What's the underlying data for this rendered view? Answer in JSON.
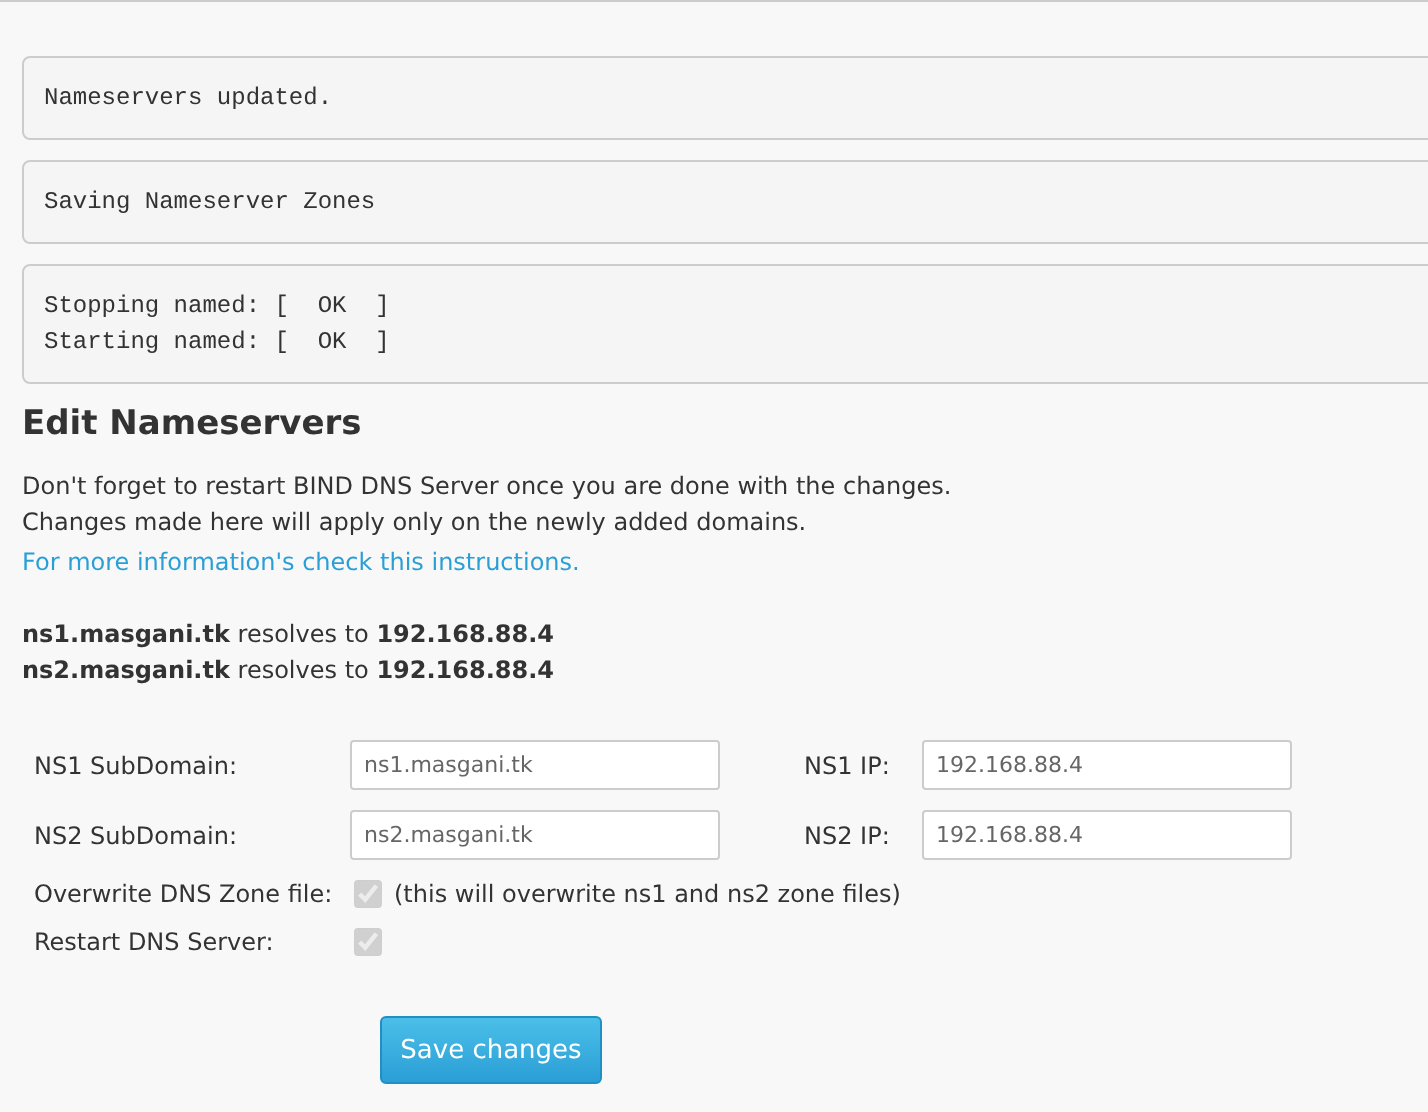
{
  "messages": [
    {
      "lines": [
        "Nameservers updated."
      ]
    },
    {
      "lines": [
        "Saving Nameserver Zones"
      ]
    },
    {
      "lines": [
        "Stopping named: [  OK  ]",
        "Starting named: [  OK  ]"
      ]
    }
  ],
  "heading": "Edit Nameservers",
  "notes": [
    "Don't forget to restart BIND DNS Server once you are done with the changes.",
    "Changes made here will apply only on the newly added domains."
  ],
  "link": "For more information's check this instructions.",
  "resolves": [
    "**ns1.masgani.tk** resolves to **192.168.88.4**",
    "**ns2.masgani.tk** resolves to **192.168.88.4**"
  ],
  "fields": [
    {
      "label": "NS1 SubDomain:",
      "value": "ns1.masgani.tk",
      "ip_label": "NS1 IP:",
      "ip_value": "192.168.88.4"
    },
    {
      "label": "NS2 SubDomain:",
      "value": "ns2.masgani.tk",
      "ip_label": "NS2 IP:",
      "ip_value": "192.168.88.4"
    }
  ],
  "options": [
    {
      "label": "Overwrite DNS Zone file:",
      "checked": true,
      "disabled": true,
      "hint": "(this will overwrite ns1 and ns2 zone files)"
    },
    {
      "label": "Restart DNS Server:",
      "checked": true,
      "disabled": true
    }
  ],
  "button": "Save changes"
}
